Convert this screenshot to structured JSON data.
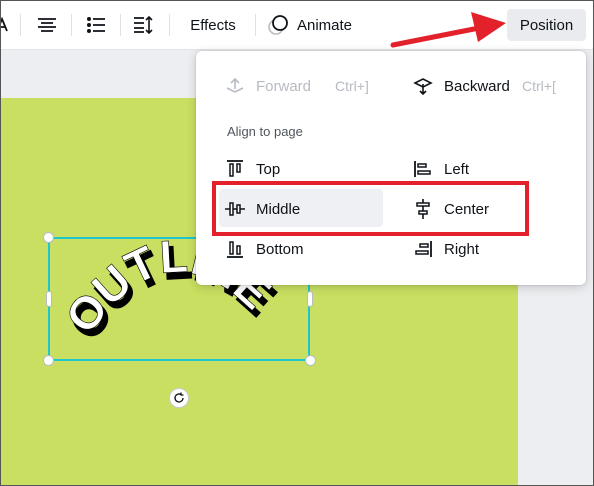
{
  "toolbar": {
    "effects_label": "Effects",
    "animate_label": "Animate",
    "position_label": "Position"
  },
  "canvas": {
    "curved_text": "OUTLINE",
    "background_color": "#c8df61",
    "selection_color": "#20c4cb"
  },
  "position_menu": {
    "forward_label": "Forward",
    "forward_shortcut": "Ctrl+]",
    "backward_label": "Backward",
    "backward_shortcut": "Ctrl+[",
    "section_title": "Align to page",
    "top_label": "Top",
    "left_label": "Left",
    "middle_label": "Middle",
    "center_label": "Center",
    "bottom_label": "Bottom",
    "right_label": "Right"
  },
  "annotations": {
    "arrow_color": "#e2212a",
    "highlight_color": "#e2212a"
  }
}
